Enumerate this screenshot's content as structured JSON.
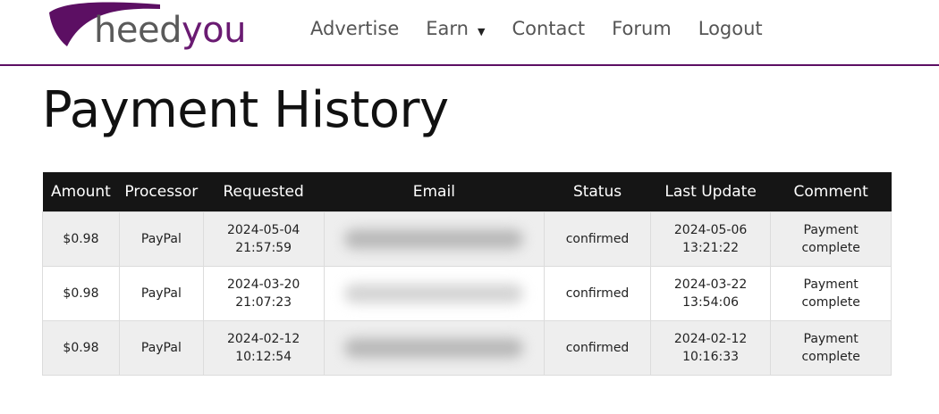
{
  "header": {
    "logo": {
      "part1": "heed",
      "part2": "you"
    },
    "nav": [
      {
        "label": "Advertise"
      },
      {
        "label": "Earn",
        "has_dropdown": true
      },
      {
        "label": "Contact"
      },
      {
        "label": "Forum"
      },
      {
        "label": "Logout"
      }
    ],
    "accent_color": "#5c0f63"
  },
  "page_title": "Payment History",
  "table": {
    "columns": [
      "Amount",
      "Processor",
      "Requested",
      "Email",
      "Status",
      "Last Update",
      "Comment"
    ],
    "rows": [
      {
        "amount": "$0.98",
        "processor": "PayPal",
        "requested_date": "2024-05-04",
        "requested_time": "21:57:59",
        "email": "",
        "status": "confirmed",
        "updated_date": "2024-05-06",
        "updated_time": "13:21:22",
        "comment_line1": "Payment",
        "comment_line2": "complete"
      },
      {
        "amount": "$0.98",
        "processor": "PayPal",
        "requested_date": "2024-03-20",
        "requested_time": "21:07:23",
        "email": "",
        "status": "confirmed",
        "updated_date": "2024-03-22",
        "updated_time": "13:54:06",
        "comment_line1": "Payment",
        "comment_line2": "complete"
      },
      {
        "amount": "$0.98",
        "processor": "PayPal",
        "requested_date": "2024-02-12",
        "requested_time": "10:12:54",
        "email": "",
        "status": "confirmed",
        "updated_date": "2024-02-12",
        "updated_time": "10:16:33",
        "comment_line1": "Payment",
        "comment_line2": "complete"
      }
    ]
  }
}
